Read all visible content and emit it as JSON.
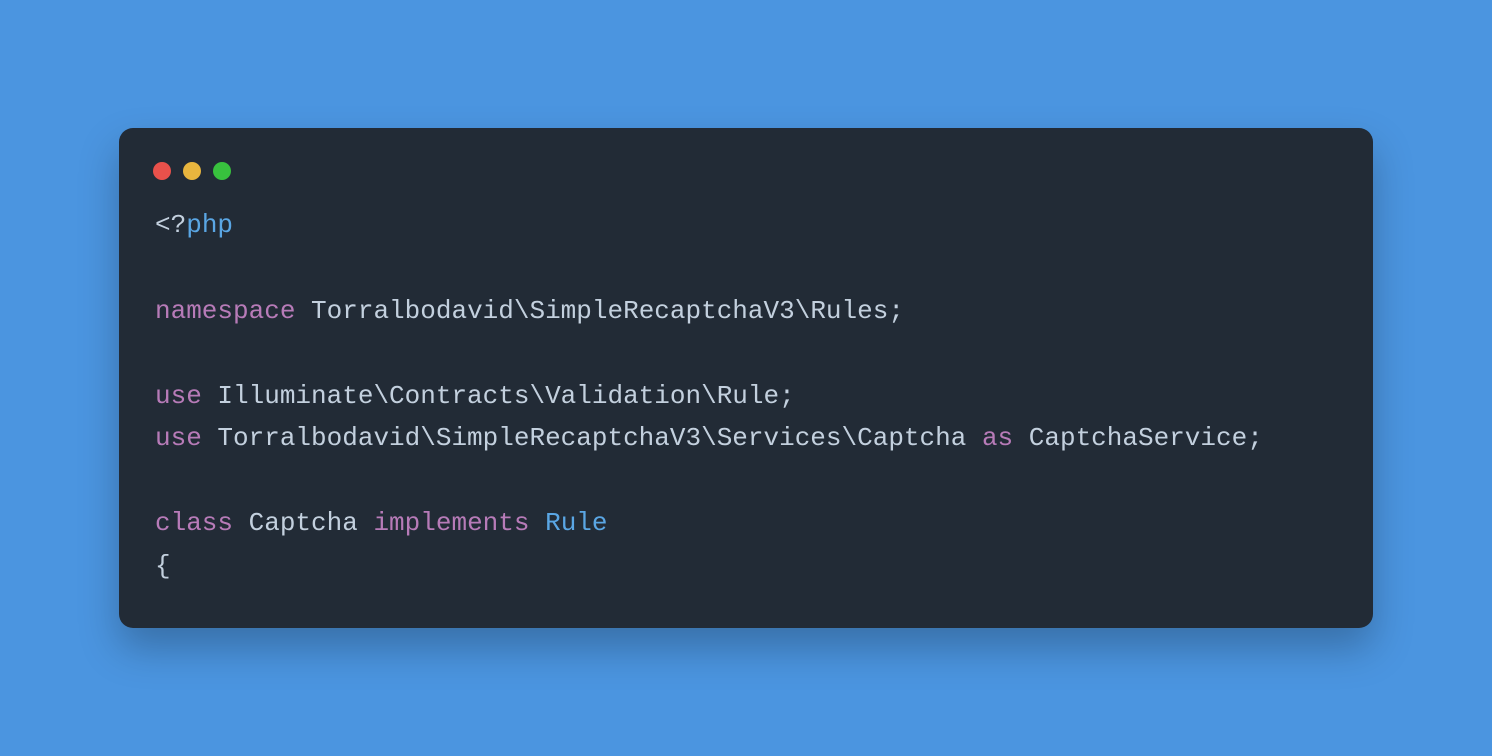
{
  "code": {
    "lines": [
      [
        {
          "t": "<?",
          "c": "tok-default"
        },
        {
          "t": "php",
          "c": "tok-php"
        }
      ],
      [],
      [
        {
          "t": "namespace",
          "c": "tok-keyword"
        },
        {
          "t": " Torralbodavid\\SimpleRecaptchaV3\\Rules;",
          "c": "tok-default"
        }
      ],
      [],
      [
        {
          "t": "use",
          "c": "tok-keyword"
        },
        {
          "t": " Illuminate\\Contracts\\Validation\\Rule;",
          "c": "tok-default"
        }
      ],
      [
        {
          "t": "use",
          "c": "tok-keyword"
        },
        {
          "t": " Torralbodavid\\SimpleRecaptchaV3\\Services\\Captcha ",
          "c": "tok-default"
        },
        {
          "t": "as",
          "c": "tok-keyword"
        },
        {
          "t": " CaptchaService;",
          "c": "tok-default"
        }
      ],
      [],
      [
        {
          "t": "class",
          "c": "tok-keyword"
        },
        {
          "t": " Captcha ",
          "c": "tok-default"
        },
        {
          "t": "implements",
          "c": "tok-keyword"
        },
        {
          "t": " ",
          "c": "tok-default"
        },
        {
          "t": "Rule",
          "c": "tok-php"
        }
      ],
      [
        {
          "t": "{",
          "c": "tok-default"
        }
      ]
    ]
  }
}
